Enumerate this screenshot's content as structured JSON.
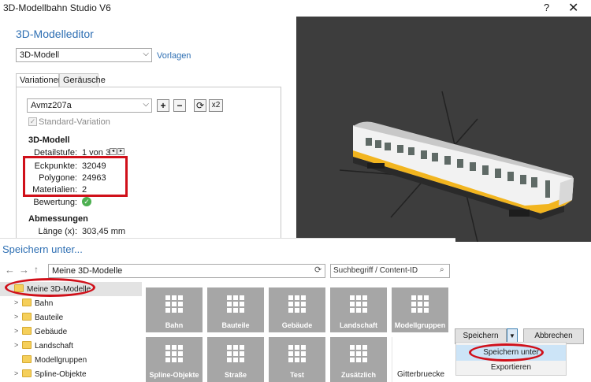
{
  "window": {
    "title": "3D-Modellbahn Studio V6",
    "help_label": "?",
    "close_label": "✕"
  },
  "editor": {
    "title": "3D-Modelleditor",
    "model_select": "3D-Modell",
    "presets_link": "Vorlagen",
    "tabs": [
      {
        "label": "Variationen"
      },
      {
        "label": "Geräusche"
      }
    ],
    "variation_select": "Avmz207a",
    "buttons": {
      "add": "+",
      "remove": "−",
      "refresh": "⟳",
      "duplicate": "x2"
    },
    "standard_variation_label": "Standard-Variation",
    "standard_variation_checked": true,
    "section_model": "3D-Modell",
    "detail_label": "Detailstufe:",
    "detail_value": "1 von 3",
    "stats": [
      {
        "label": "Eckpunkte:",
        "value": "32049"
      },
      {
        "label": "Polygone:",
        "value": "24963"
      },
      {
        "label": "Materialien:",
        "value": "2"
      }
    ],
    "rating_label": "Bewertung:",
    "section_dimensions": "Abmessungen",
    "length_label": "Länge (x):",
    "length_value": "303,45 mm"
  },
  "save_dialog": {
    "title": "Speichern unter...",
    "path": "Meine 3D-Modelle",
    "search_placeholder": "Suchbegriff / Content-ID",
    "tree": [
      {
        "label": "Meine 3D-Modelle",
        "selected": true
      },
      {
        "label": "Bahn"
      },
      {
        "label": "Bauteile"
      },
      {
        "label": "Gebäude"
      },
      {
        "label": "Landschaft"
      },
      {
        "label": "Modellgruppen"
      },
      {
        "label": "Spline-Objekte"
      }
    ],
    "tiles": [
      {
        "label": "Bahn"
      },
      {
        "label": "Bauteile"
      },
      {
        "label": "Gebäude"
      },
      {
        "label": "Landschaft"
      },
      {
        "label": "Modellgruppen"
      },
      {
        "label": "Spline-Objekte"
      },
      {
        "label": "Straße"
      },
      {
        "label": "Test"
      },
      {
        "label": "Zusätzlich"
      },
      {
        "label": "Gitterbruecke"
      }
    ]
  },
  "actions": {
    "save_label": "Speichern",
    "cancel_label": "Abbrechen",
    "menu": [
      {
        "label": "Speichern unter"
      },
      {
        "label": "Exportieren"
      }
    ]
  },
  "colors": {
    "accent": "#2e6fb3",
    "highlight_red": "#d0101a",
    "wagon_stripe": "#f2b51f",
    "viewport_bg": "#3d3d3d"
  }
}
